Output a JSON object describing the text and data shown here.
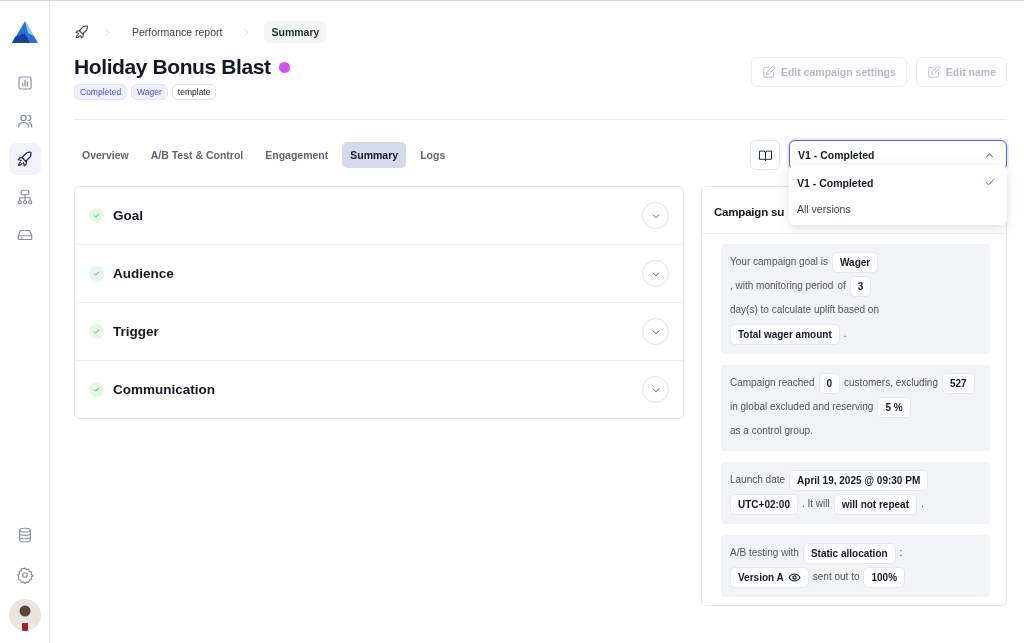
{
  "sidebar": {
    "nav": [
      {
        "selected": false
      },
      {
        "selected": false
      },
      {
        "selected": true
      },
      {
        "selected": false
      },
      {
        "selected": false
      }
    ]
  },
  "breadcrumb": [
    {
      "label": "Performance report",
      "selected": false
    },
    {
      "label": "Summary",
      "selected": true
    }
  ],
  "campaign": {
    "title": "Holiday Bonus Blast",
    "color": "#d152f0",
    "tags": [
      {
        "label": "Completed",
        "kind": "status"
      },
      {
        "label": "Wager",
        "kind": "status"
      },
      {
        "label": "template",
        "kind": "plain"
      }
    ]
  },
  "actions": [
    {
      "label": "Edit campaign settings",
      "disabled": true
    },
    {
      "label": "Edit name",
      "disabled": true
    }
  ],
  "tabs": [
    {
      "label": "Overview",
      "selected": false
    },
    {
      "label": "A/B Test & Control",
      "selected": false
    },
    {
      "label": "Engagement",
      "selected": false
    },
    {
      "label": "Summary",
      "selected": true
    },
    {
      "label": "Logs",
      "selected": false
    }
  ],
  "version_select": {
    "value": "V1 - Completed",
    "expanded": true,
    "options": [
      {
        "label": "V1 - Completed",
        "selected": true
      },
      {
        "label": "All versions",
        "selected": false
      }
    ]
  },
  "sections": [
    {
      "title": "Goal",
      "done": true,
      "expanded": false
    },
    {
      "title": "Audience",
      "done": true,
      "expanded": false
    },
    {
      "title": "Trigger",
      "done": true,
      "expanded": false
    },
    {
      "title": "Communication",
      "done": true,
      "expanded": false
    }
  ],
  "summary": {
    "title": "Campaign su",
    "cards": [
      [
        {
          "kind": "text",
          "text": "Your campaign goal is"
        },
        {
          "kind": "chip",
          "text": "Wager"
        },
        {
          "kind": "text",
          "text": ", with monitoring period"
        },
        {
          "kind": "text",
          "text": "of"
        },
        {
          "kind": "chip",
          "text": "3"
        },
        {
          "kind": "text",
          "text": "day(s) to calculate uplift based on"
        },
        {
          "kind": "chip",
          "text": "Total wager amount"
        },
        {
          "kind": "text",
          "text": "."
        }
      ],
      [
        {
          "kind": "text",
          "text": "Campaign reached"
        },
        {
          "kind": "chip",
          "text": "0"
        },
        {
          "kind": "text",
          "text": "customers, excluding"
        },
        {
          "kind": "chip",
          "text": "527"
        },
        {
          "kind": "text",
          "text": "in global excluded and reserving"
        },
        {
          "kind": "chip",
          "text": "5 %"
        },
        {
          "kind": "break"
        },
        {
          "kind": "text",
          "text": "as a control group."
        }
      ],
      [
        {
          "kind": "text",
          "text": "Launch date"
        },
        {
          "kind": "chip",
          "text": "April 19, 2025 @ 09:30 PM"
        },
        {
          "kind": "chip",
          "text": "UTC+02:00"
        },
        {
          "kind": "text",
          "text": ". It will"
        },
        {
          "kind": "chip",
          "text": "will not repeat"
        },
        {
          "kind": "text",
          "text": "."
        }
      ],
      [
        {
          "kind": "text",
          "text": "A/B testing with"
        },
        {
          "kind": "chip",
          "text": "Static allocation"
        },
        {
          "kind": "text",
          "text": ":"
        },
        {
          "kind": "break"
        },
        {
          "kind": "view-chip",
          "text": "Version A"
        },
        {
          "kind": "text",
          "text": "sent out to"
        },
        {
          "kind": "chip",
          "text": "100%"
        }
      ]
    ]
  }
}
